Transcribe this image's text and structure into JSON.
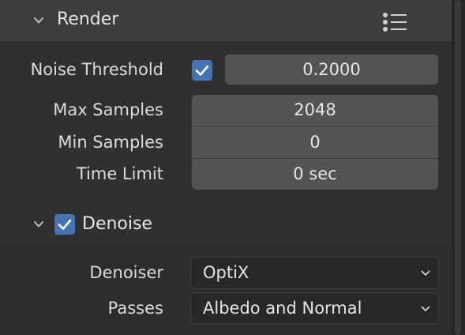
{
  "render_panel": {
    "title": "Render",
    "noise_threshold": {
      "label": "Noise Threshold",
      "enabled": true,
      "value": "0.2000"
    },
    "max_samples": {
      "label": "Max Samples",
      "value": "2048"
    },
    "min_samples": {
      "label": "Min Samples",
      "value": "0"
    },
    "time_limit": {
      "label": "Time Limit",
      "value": "0 sec"
    }
  },
  "denoise_panel": {
    "title": "Denoise",
    "enabled": true,
    "denoiser": {
      "label": "Denoiser",
      "value": "OptiX"
    },
    "passes": {
      "label": "Passes",
      "value": "Albedo and Normal"
    }
  },
  "icons": {
    "collapse": "chevron-down-icon",
    "menu": "list-menu-icon",
    "check": "checkmark-icon",
    "dropdown": "chevron-down-icon"
  },
  "colors": {
    "accent": "#4772b3",
    "field_bg": "#545454",
    "header_bg": "#3d3d3d",
    "panel_bg": "#303030",
    "dropdown_bg": "#282828"
  }
}
